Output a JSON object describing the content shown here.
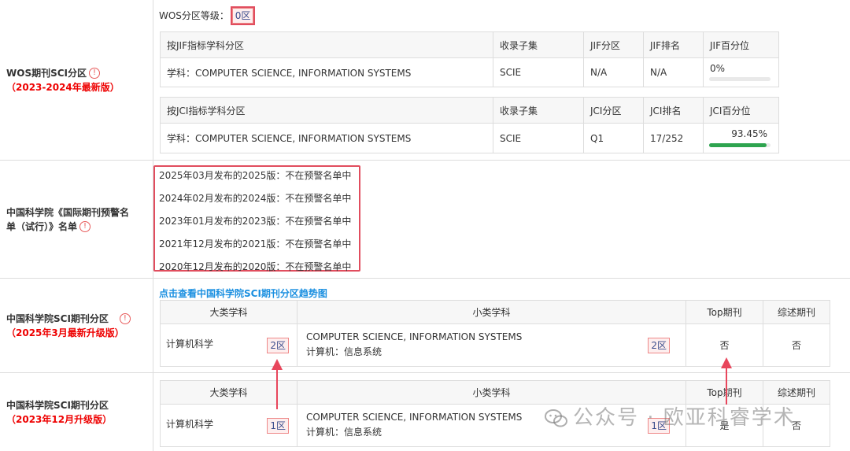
{
  "wos": {
    "label": "WOS期刊SCI分区",
    "sub": "（2023-2024年最新版）",
    "level_label": "WOS分区等级：",
    "level_value": "0区",
    "jif_table": {
      "headers": [
        "按JIF指标学科分区",
        "收录子集",
        "JIF分区",
        "JIF排名",
        "JIF百分位"
      ],
      "row": {
        "subject": "学科：COMPUTER SCIENCE, INFORMATION SYSTEMS",
        "subset": "SCIE",
        "zone": "N/A",
        "rank": "N/A",
        "percentile": "0%",
        "percentile_fraction": 0.0
      }
    },
    "jci_table": {
      "headers": [
        "按JCI指标学科分区",
        "收录子集",
        "JCI分区",
        "JCI排名",
        "JCI百分位"
      ],
      "row": {
        "subject": "学科：COMPUTER SCIENCE, INFORMATION SYSTEMS",
        "subset": "SCIE",
        "zone": "Q1",
        "rank": "17/252",
        "percentile": "93.45%",
        "percentile_fraction": 0.9345
      }
    }
  },
  "cas_warning": {
    "label": "中国科学院《国际期刊预警名单（试行）》名单",
    "items": [
      "2025年03月发布的2025版：不在预警名单中",
      "2024年02月发布的2024版：不在预警名单中",
      "2023年01月发布的2023版：不在预警名单中",
      "2021年12月发布的2021版：不在预警名单中",
      "2020年12月发布的2020版：不在预警名单中"
    ]
  },
  "cas_2025": {
    "label": "中国科学院SCI期刊分区",
    "sub": "（2025年3月最新升级版）",
    "trend_link": "点击查看中国科学院SCI期刊分区趋势图",
    "headers": [
      "大类学科",
      "小类学科",
      "Top期刊",
      "综述期刊"
    ],
    "row": {
      "major": "计算机科学",
      "major_zone": "2区",
      "minor_en": "COMPUTER SCIENCE, INFORMATION SYSTEMS",
      "minor_cn": "计算机：信息系统",
      "minor_zone": "2区",
      "top": "否",
      "review": "否"
    }
  },
  "cas_2023": {
    "label": "中国科学院SCI期刊分区",
    "sub": "（2023年12月升级版）",
    "headers": [
      "大类学科",
      "小类学科",
      "Top期刊",
      "综述期刊"
    ],
    "row": {
      "major": "计算机科学",
      "major_zone": "1区",
      "minor_en": "COMPUTER SCIENCE, INFORMATION SYSTEMS",
      "minor_cn": "计算机：信息系统",
      "minor_zone": "1区",
      "top": "是",
      "review": "否"
    }
  },
  "watermark": "公众号 · 欧亚科睿学术",
  "colors": {
    "accent_red": "#e14d5e",
    "link_blue": "#1a8fe0",
    "bar_green": "#2ea44f"
  }
}
